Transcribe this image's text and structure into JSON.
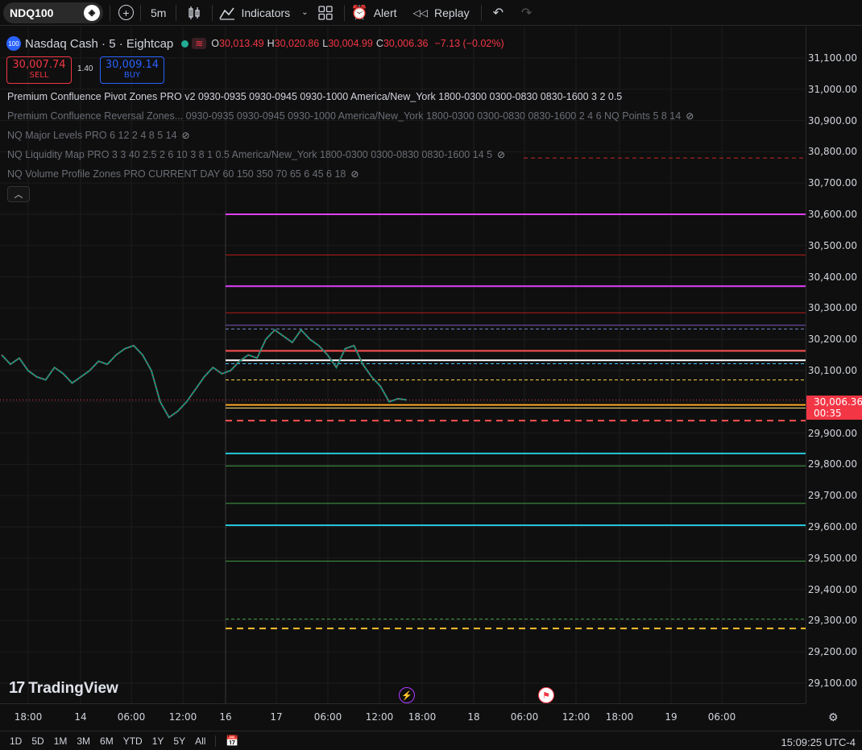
{
  "toolbar": {
    "symbol": "NDQ100",
    "interval": "5m",
    "indicators_label": "Indicators",
    "alert_label": "Alert",
    "replay_label": "Replay"
  },
  "legend": {
    "logo": "100",
    "title": "Nasdaq Cash · 5 · Eightcap",
    "open_label": "O",
    "open": "30,013.49",
    "high_label": "H",
    "high": "30,020.86",
    "low_label": "L",
    "low": "30,004.99",
    "close_label": "C",
    "close": "30,006.36",
    "change": "−7.13 (−0.02%)"
  },
  "trade": {
    "sell_price": "30,007.74",
    "sell_label": "SELL",
    "spread": "1.40",
    "buy_price": "30,009.14",
    "buy_label": "BUY"
  },
  "indicators": [
    {
      "text": "Premium Confluence Pivot Zones PRO v2 0930-0935 0930-0945 0930-1000 America/New_York 1800-0300 0300-0830 0830-1600 3 2 0.5",
      "enabled": true
    },
    {
      "text": "Premium Confluence Reversal Zones... 0930-0935 0930-0945 0930-1000 America/New_York 1800-0300 0300-0830 0830-1600 2 4 6 NQ Points 5 8 14",
      "enabled": false
    },
    {
      "text": "NQ Major Levels PRO 6 12 2 4 8 5 14",
      "enabled": false
    },
    {
      "text": "NQ Liquidity Map PRO 3 3 40 2.5 2 6 10 3 8 1 0.5 America/New_York 1800-0300 0300-0830 0830-1600 14 5",
      "enabled": false
    },
    {
      "text": "NQ Volume Profile Zones PRO CURRENT DAY 60 150 350 70 65 6 45 6 18",
      "enabled": false
    }
  ],
  "price_axis": [
    "31,100.00",
    "31,000.00",
    "30,900.00",
    "30,800.00",
    "30,700.00",
    "30,600.00",
    "30,500.00",
    "30,400.00",
    "30,300.00",
    "30,200.00",
    "30,100.00",
    "29,900.00",
    "29,800.00",
    "29,700.00",
    "29,600.00",
    "29,500.00",
    "29,400.00",
    "29,300.00",
    "29,200.00",
    "29,100.00"
  ],
  "current_price": {
    "value": "30,006.36",
    "countdown": "00:35",
    "color": "#f23645"
  },
  "time_axis": [
    "18:00",
    "14",
    "06:00",
    "12:00",
    "16",
    "17",
    "06:00",
    "12:00",
    "18:00",
    "18",
    "06:00",
    "12:00",
    "18:00",
    "19",
    "06:00"
  ],
  "ranges": [
    "1D",
    "5D",
    "1M",
    "3M",
    "6M",
    "YTD",
    "1Y",
    "5Y",
    "All"
  ],
  "clock": "15:09:25 UTC-4",
  "branding": "TradingView",
  "chart_data": {
    "type": "line",
    "levels": [
      {
        "price": 30600,
        "color": "#e040fb",
        "style": "solid",
        "width": 2
      },
      {
        "price": 30470,
        "color": "#b71c1c",
        "style": "solid",
        "width": 1
      },
      {
        "price": 30370,
        "color": "#e040fb",
        "style": "solid",
        "width": 2
      },
      {
        "price": 30285,
        "color": "#b71c1c",
        "style": "solid",
        "width": 1
      },
      {
        "price": 30245,
        "color": "#7e57c2",
        "style": "solid",
        "width": 1
      },
      {
        "price": 30233,
        "color": "#7986cb",
        "style": "dashed",
        "width": 1
      },
      {
        "price": 30163,
        "color": "#ff5252",
        "style": "solid",
        "width": 2
      },
      {
        "price": 30133,
        "color": "#ffffff",
        "style": "solid",
        "width": 2
      },
      {
        "price": 30122,
        "color": "#4fc3f7",
        "style": "dashed",
        "width": 1
      },
      {
        "price": 30070,
        "color": "#ffd54f",
        "style": "dashed",
        "width": 1
      },
      {
        "price": 29990,
        "color": "#ffa726",
        "style": "solid",
        "width": 2
      },
      {
        "price": 29980,
        "color": "#ffe082",
        "style": "solid",
        "width": 1
      },
      {
        "price": 29940,
        "color": "#ff5252",
        "style": "dashed",
        "width": 2
      },
      {
        "price": 29835,
        "color": "#26c6da",
        "style": "solid",
        "width": 2
      },
      {
        "price": 29795,
        "color": "#43a047",
        "style": "solid",
        "width": 1
      },
      {
        "price": 29675,
        "color": "#43a047",
        "style": "solid",
        "width": 1
      },
      {
        "price": 29605,
        "color": "#26c6da",
        "style": "solid",
        "width": 2
      },
      {
        "price": 29490,
        "color": "#43a047",
        "style": "solid",
        "width": 1
      },
      {
        "price": 29305,
        "color": "#43a047",
        "style": "dashed",
        "width": 1
      },
      {
        "price": 29275,
        "color": "#fbc02d",
        "style": "dashed",
        "width": 2
      }
    ],
    "top_red_dashed": 30780,
    "price_path": [
      30150,
      30120,
      30140,
      30100,
      30080,
      30070,
      30110,
      30090,
      30060,
      30080,
      30100,
      30130,
      30120,
      30150,
      30170,
      30180,
      30150,
      30100,
      30000,
      29950,
      29970,
      30000,
      30040,
      30080,
      30110,
      30090,
      30100,
      30130,
      30150,
      30140,
      30200,
      30230,
      30210,
      30190,
      30230,
      30200,
      30180,
      30150,
      30110,
      30170,
      30180,
      30120,
      30080,
      30050,
      30000,
      30010,
      30006
    ],
    "ylim": [
      29080,
      31140
    ]
  }
}
